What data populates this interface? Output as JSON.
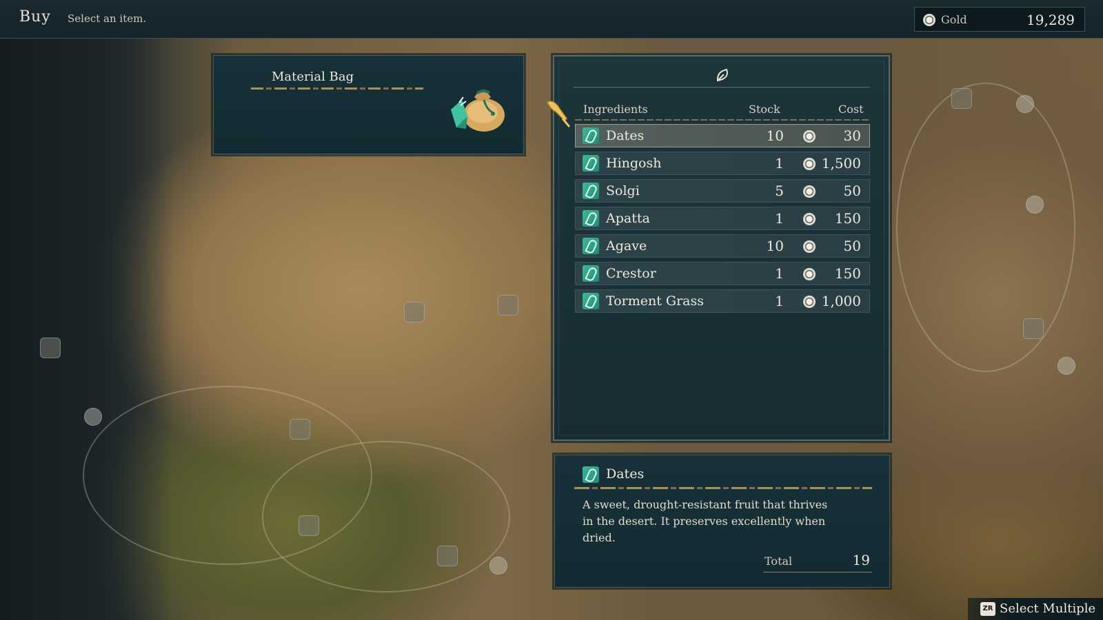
{
  "header": {
    "title": "Buy",
    "hint": "Select an item."
  },
  "currency": {
    "label": "Gold",
    "value": "19,289"
  },
  "preview": {
    "title": "Material Bag",
    "icon": "material-bag-icon"
  },
  "shop": {
    "tab_icon": "leaf-tab-icon",
    "columns": {
      "name": "Ingredients",
      "stock": "Stock",
      "cost": "Cost"
    },
    "selected_index": 0,
    "items": [
      {
        "name": "Dates",
        "stock": "10",
        "cost": "30"
      },
      {
        "name": "Hingosh",
        "stock": "1",
        "cost": "1,500"
      },
      {
        "name": "Solgi",
        "stock": "5",
        "cost": "50"
      },
      {
        "name": "Apatta",
        "stock": "1",
        "cost": "150"
      },
      {
        "name": "Agave",
        "stock": "10",
        "cost": "50"
      },
      {
        "name": "Crestor",
        "stock": "1",
        "cost": "150"
      },
      {
        "name": "Torment Grass",
        "stock": "1",
        "cost": "1,000"
      }
    ]
  },
  "detail": {
    "name": "Dates",
    "description": "A sweet, drought-resistant fruit that thrives in the desert. It preserves excellently when dried.",
    "total_label": "Total",
    "total_value": "19"
  },
  "prompt": {
    "button": "ZR",
    "label": "Select Multiple"
  },
  "colors": {
    "panel": "#18313a",
    "accent_gold": "#a8925a",
    "item_icon": "#2fa585",
    "selected_row": "#54605d"
  }
}
